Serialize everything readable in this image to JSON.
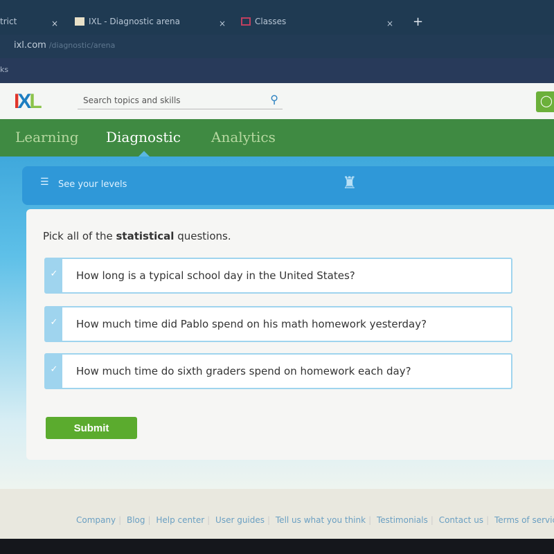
{
  "browser": {
    "tabs": [
      {
        "label": "trict"
      },
      {
        "label": "IXL - Diagnostic arena"
      },
      {
        "label": "Classes"
      }
    ],
    "new_tab": "+",
    "close": "×",
    "address": "ixl.com",
    "address_path": "/diagnostic/arena",
    "bookmarks": "ks"
  },
  "header": {
    "logo": {
      "i": "I",
      "x": "X",
      "l": "L"
    },
    "search_placeholder": "Search topics and skills",
    "search_icon": "search-icon",
    "user_icon": "user-icon"
  },
  "nav": {
    "items": [
      {
        "label": "Learning"
      },
      {
        "label": "Diagnostic"
      },
      {
        "label": "Analytics"
      }
    ],
    "active": "Diagnostic"
  },
  "levels": {
    "label": "See your levels"
  },
  "question": {
    "prefix": "Pick all of the ",
    "bold": "statistical",
    "suffix": " questions.",
    "options": [
      {
        "text": "How long is a typical school day in the United States?",
        "selected": true
      },
      {
        "text": "How much time did Pablo spend on his math homework yesterday?",
        "selected": true
      },
      {
        "text": "How much time do sixth graders spend on homework each day?",
        "selected": true
      }
    ],
    "check": "✓",
    "submit": "Submit"
  },
  "footer": {
    "links": [
      "Company",
      "Blog",
      "Help center",
      "User guides",
      "Tell us what you think",
      "Testimonials",
      "Contact us",
      "Terms of service"
    ]
  },
  "colors": {
    "nav_green": "#3f8a42",
    "accent_blue": "#2f98d8",
    "submit_green": "#5bab2e"
  }
}
